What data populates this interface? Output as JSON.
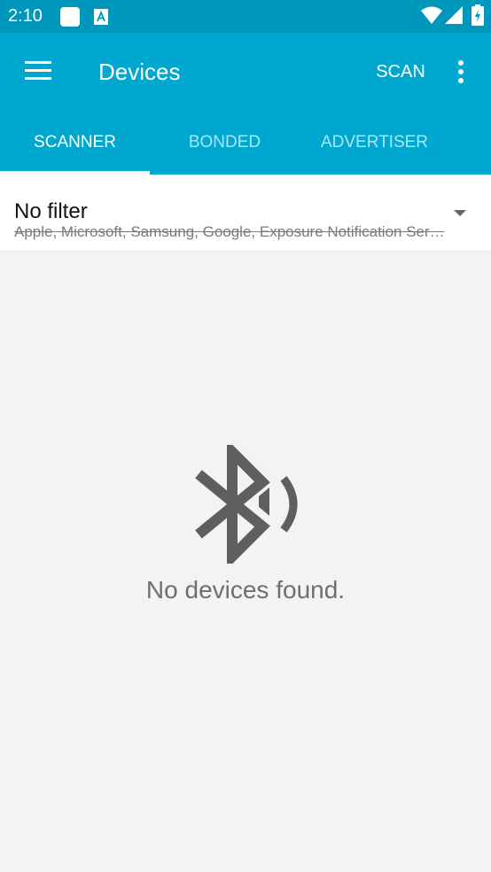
{
  "status_bar": {
    "time": "2:10",
    "notification_icons": [
      "square-app-icon",
      "font-a-icon"
    ],
    "system_icons": [
      "wifi-icon",
      "cell-signal-icon",
      "battery-icon"
    ]
  },
  "app_bar": {
    "title": "Devices",
    "scan_label": "SCAN",
    "menu_icon": "hamburger-menu-icon",
    "overflow_icon": "more-vert-icon"
  },
  "tabs": [
    {
      "label": "SCANNER",
      "active": true
    },
    {
      "label": "BONDED",
      "active": false
    },
    {
      "label": "ADVERTISER",
      "active": false
    }
  ],
  "filter": {
    "title": "No filter",
    "subtitle": "Apple, Microsoft, Samsung, Google, Exposure Notification Ser…"
  },
  "empty_state": {
    "icon": "bluetooth-searching-icon",
    "message": "No devices found."
  },
  "colors": {
    "status_bar": "#0097bd",
    "app_bar": "#00a8cf",
    "tab_inactive_text": "#a8e6f6",
    "background": "#f3f3f3",
    "icon_gray": "#5f5f5f"
  }
}
